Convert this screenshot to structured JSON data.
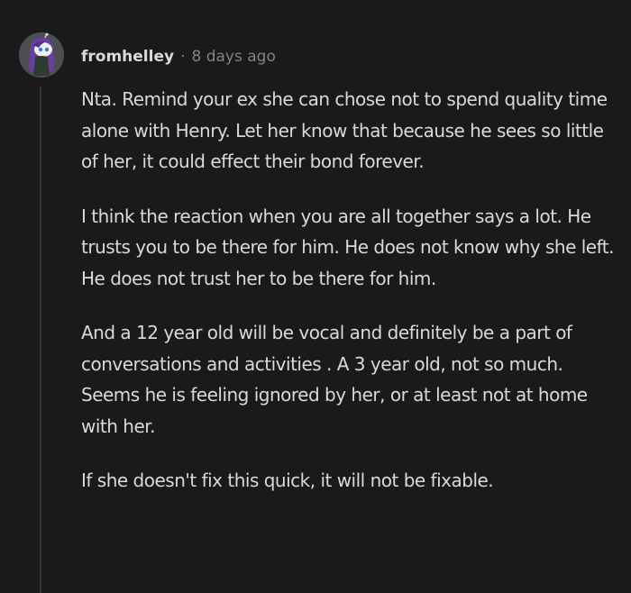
{
  "comment": {
    "author": "fromhelley",
    "separator": "·",
    "timestamp": "8 days ago",
    "paragraphs": [
      "Nta. Remind your ex she can chose not to spend quality time alone with Henry. Let her know that because he sees so little of her, it could effect their bond forever.",
      "I think the reaction when you are all together says a lot. He trusts you to be there for him. He does not know why she left. He does not trust her to be there for him.",
      "And a 12 year old will be vocal and definitely be a part of conversations and activities . A 3 year old, not so much. Seems he is feeling ignored by her, or at least not at home with her.",
      "If she doesn't fix this quick, it will not be fixable."
    ]
  },
  "avatar": {
    "icon": "snoo-avatar-icon",
    "hair_color": "#6b3fa0",
    "face_color": "#f0f0f0",
    "eye_color": "#3a7bd5"
  },
  "colors": {
    "background": "#1a1a1b",
    "text": "#d7dadc",
    "meta": "#818384",
    "thread_line": "#343536"
  }
}
